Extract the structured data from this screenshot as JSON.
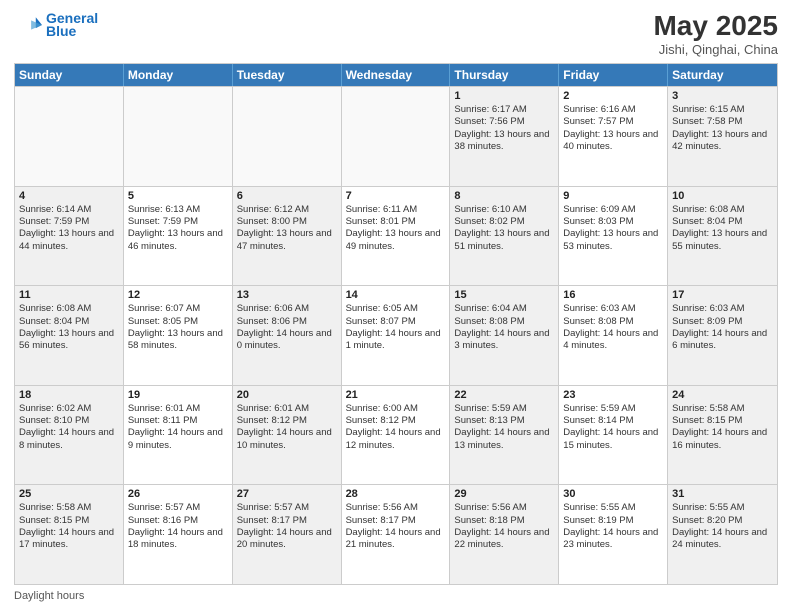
{
  "header": {
    "logo_line1": "General",
    "logo_line2": "Blue",
    "month_title": "May 2025",
    "location": "Jishi, Qinghai, China"
  },
  "days_of_week": [
    "Sunday",
    "Monday",
    "Tuesday",
    "Wednesday",
    "Thursday",
    "Friday",
    "Saturday"
  ],
  "footer": {
    "daylight_label": "Daylight hours"
  },
  "weeks": [
    [
      {
        "day": "",
        "sunrise": "",
        "sunset": "",
        "daylight": "",
        "empty": true
      },
      {
        "day": "",
        "sunrise": "",
        "sunset": "",
        "daylight": "",
        "empty": true
      },
      {
        "day": "",
        "sunrise": "",
        "sunset": "",
        "daylight": "",
        "empty": true
      },
      {
        "day": "",
        "sunrise": "",
        "sunset": "",
        "daylight": "",
        "empty": true
      },
      {
        "day": "1",
        "sunrise": "Sunrise: 6:17 AM",
        "sunset": "Sunset: 7:56 PM",
        "daylight": "Daylight: 13 hours and 38 minutes.",
        "empty": false
      },
      {
        "day": "2",
        "sunrise": "Sunrise: 6:16 AM",
        "sunset": "Sunset: 7:57 PM",
        "daylight": "Daylight: 13 hours and 40 minutes.",
        "empty": false
      },
      {
        "day": "3",
        "sunrise": "Sunrise: 6:15 AM",
        "sunset": "Sunset: 7:58 PM",
        "daylight": "Daylight: 13 hours and 42 minutes.",
        "empty": false
      }
    ],
    [
      {
        "day": "4",
        "sunrise": "Sunrise: 6:14 AM",
        "sunset": "Sunset: 7:59 PM",
        "daylight": "Daylight: 13 hours and 44 minutes.",
        "empty": false
      },
      {
        "day": "5",
        "sunrise": "Sunrise: 6:13 AM",
        "sunset": "Sunset: 7:59 PM",
        "daylight": "Daylight: 13 hours and 46 minutes.",
        "empty": false
      },
      {
        "day": "6",
        "sunrise": "Sunrise: 6:12 AM",
        "sunset": "Sunset: 8:00 PM",
        "daylight": "Daylight: 13 hours and 47 minutes.",
        "empty": false
      },
      {
        "day": "7",
        "sunrise": "Sunrise: 6:11 AM",
        "sunset": "Sunset: 8:01 PM",
        "daylight": "Daylight: 13 hours and 49 minutes.",
        "empty": false
      },
      {
        "day": "8",
        "sunrise": "Sunrise: 6:10 AM",
        "sunset": "Sunset: 8:02 PM",
        "daylight": "Daylight: 13 hours and 51 minutes.",
        "empty": false
      },
      {
        "day": "9",
        "sunrise": "Sunrise: 6:09 AM",
        "sunset": "Sunset: 8:03 PM",
        "daylight": "Daylight: 13 hours and 53 minutes.",
        "empty": false
      },
      {
        "day": "10",
        "sunrise": "Sunrise: 6:08 AM",
        "sunset": "Sunset: 8:04 PM",
        "daylight": "Daylight: 13 hours and 55 minutes.",
        "empty": false
      }
    ],
    [
      {
        "day": "11",
        "sunrise": "Sunrise: 6:08 AM",
        "sunset": "Sunset: 8:04 PM",
        "daylight": "Daylight: 13 hours and 56 minutes.",
        "empty": false
      },
      {
        "day": "12",
        "sunrise": "Sunrise: 6:07 AM",
        "sunset": "Sunset: 8:05 PM",
        "daylight": "Daylight: 13 hours and 58 minutes.",
        "empty": false
      },
      {
        "day": "13",
        "sunrise": "Sunrise: 6:06 AM",
        "sunset": "Sunset: 8:06 PM",
        "daylight": "Daylight: 14 hours and 0 minutes.",
        "empty": false
      },
      {
        "day": "14",
        "sunrise": "Sunrise: 6:05 AM",
        "sunset": "Sunset: 8:07 PM",
        "daylight": "Daylight: 14 hours and 1 minute.",
        "empty": false
      },
      {
        "day": "15",
        "sunrise": "Sunrise: 6:04 AM",
        "sunset": "Sunset: 8:08 PM",
        "daylight": "Daylight: 14 hours and 3 minutes.",
        "empty": false
      },
      {
        "day": "16",
        "sunrise": "Sunrise: 6:03 AM",
        "sunset": "Sunset: 8:08 PM",
        "daylight": "Daylight: 14 hours and 4 minutes.",
        "empty": false
      },
      {
        "day": "17",
        "sunrise": "Sunrise: 6:03 AM",
        "sunset": "Sunset: 8:09 PM",
        "daylight": "Daylight: 14 hours and 6 minutes.",
        "empty": false
      }
    ],
    [
      {
        "day": "18",
        "sunrise": "Sunrise: 6:02 AM",
        "sunset": "Sunset: 8:10 PM",
        "daylight": "Daylight: 14 hours and 8 minutes.",
        "empty": false
      },
      {
        "day": "19",
        "sunrise": "Sunrise: 6:01 AM",
        "sunset": "Sunset: 8:11 PM",
        "daylight": "Daylight: 14 hours and 9 minutes.",
        "empty": false
      },
      {
        "day": "20",
        "sunrise": "Sunrise: 6:01 AM",
        "sunset": "Sunset: 8:12 PM",
        "daylight": "Daylight: 14 hours and 10 minutes.",
        "empty": false
      },
      {
        "day": "21",
        "sunrise": "Sunrise: 6:00 AM",
        "sunset": "Sunset: 8:12 PM",
        "daylight": "Daylight: 14 hours and 12 minutes.",
        "empty": false
      },
      {
        "day": "22",
        "sunrise": "Sunrise: 5:59 AM",
        "sunset": "Sunset: 8:13 PM",
        "daylight": "Daylight: 14 hours and 13 minutes.",
        "empty": false
      },
      {
        "day": "23",
        "sunrise": "Sunrise: 5:59 AM",
        "sunset": "Sunset: 8:14 PM",
        "daylight": "Daylight: 14 hours and 15 minutes.",
        "empty": false
      },
      {
        "day": "24",
        "sunrise": "Sunrise: 5:58 AM",
        "sunset": "Sunset: 8:15 PM",
        "daylight": "Daylight: 14 hours and 16 minutes.",
        "empty": false
      }
    ],
    [
      {
        "day": "25",
        "sunrise": "Sunrise: 5:58 AM",
        "sunset": "Sunset: 8:15 PM",
        "daylight": "Daylight: 14 hours and 17 minutes.",
        "empty": false
      },
      {
        "day": "26",
        "sunrise": "Sunrise: 5:57 AM",
        "sunset": "Sunset: 8:16 PM",
        "daylight": "Daylight: 14 hours and 18 minutes.",
        "empty": false
      },
      {
        "day": "27",
        "sunrise": "Sunrise: 5:57 AM",
        "sunset": "Sunset: 8:17 PM",
        "daylight": "Daylight: 14 hours and 20 minutes.",
        "empty": false
      },
      {
        "day": "28",
        "sunrise": "Sunrise: 5:56 AM",
        "sunset": "Sunset: 8:17 PM",
        "daylight": "Daylight: 14 hours and 21 minutes.",
        "empty": false
      },
      {
        "day": "29",
        "sunrise": "Sunrise: 5:56 AM",
        "sunset": "Sunset: 8:18 PM",
        "daylight": "Daylight: 14 hours and 22 minutes.",
        "empty": false
      },
      {
        "day": "30",
        "sunrise": "Sunrise: 5:55 AM",
        "sunset": "Sunset: 8:19 PM",
        "daylight": "Daylight: 14 hours and 23 minutes.",
        "empty": false
      },
      {
        "day": "31",
        "sunrise": "Sunrise: 5:55 AM",
        "sunset": "Sunset: 8:20 PM",
        "daylight": "Daylight: 14 hours and 24 minutes.",
        "empty": false
      }
    ]
  ]
}
